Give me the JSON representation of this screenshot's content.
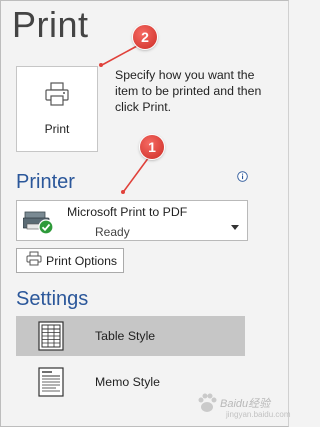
{
  "page": {
    "title": "Print"
  },
  "print_button": {
    "label": "Print",
    "icon": "printer-icon"
  },
  "instructions": "Specify how you want the item to be printed and then click Print.",
  "printer": {
    "section_title": "Printer",
    "info_icon": "info-icon",
    "selected_printer": "Microsoft Print to PDF",
    "status": "Ready",
    "options_label": "Print Options"
  },
  "settings": {
    "section_title": "Settings",
    "styles": [
      {
        "label": "Table Style",
        "icon": "table-style-icon",
        "selected": true
      },
      {
        "label": "Memo Style",
        "icon": "memo-style-icon",
        "selected": false
      }
    ]
  },
  "callouts": [
    "2",
    "1"
  ],
  "watermark": {
    "text": "Baidu经验",
    "sub": "jingyan.baidu.com"
  },
  "colors": {
    "accent": "#2b579a",
    "callout": "#e0413a",
    "selected_bg": "#c6c6c6",
    "background": "#f3f3f3"
  }
}
